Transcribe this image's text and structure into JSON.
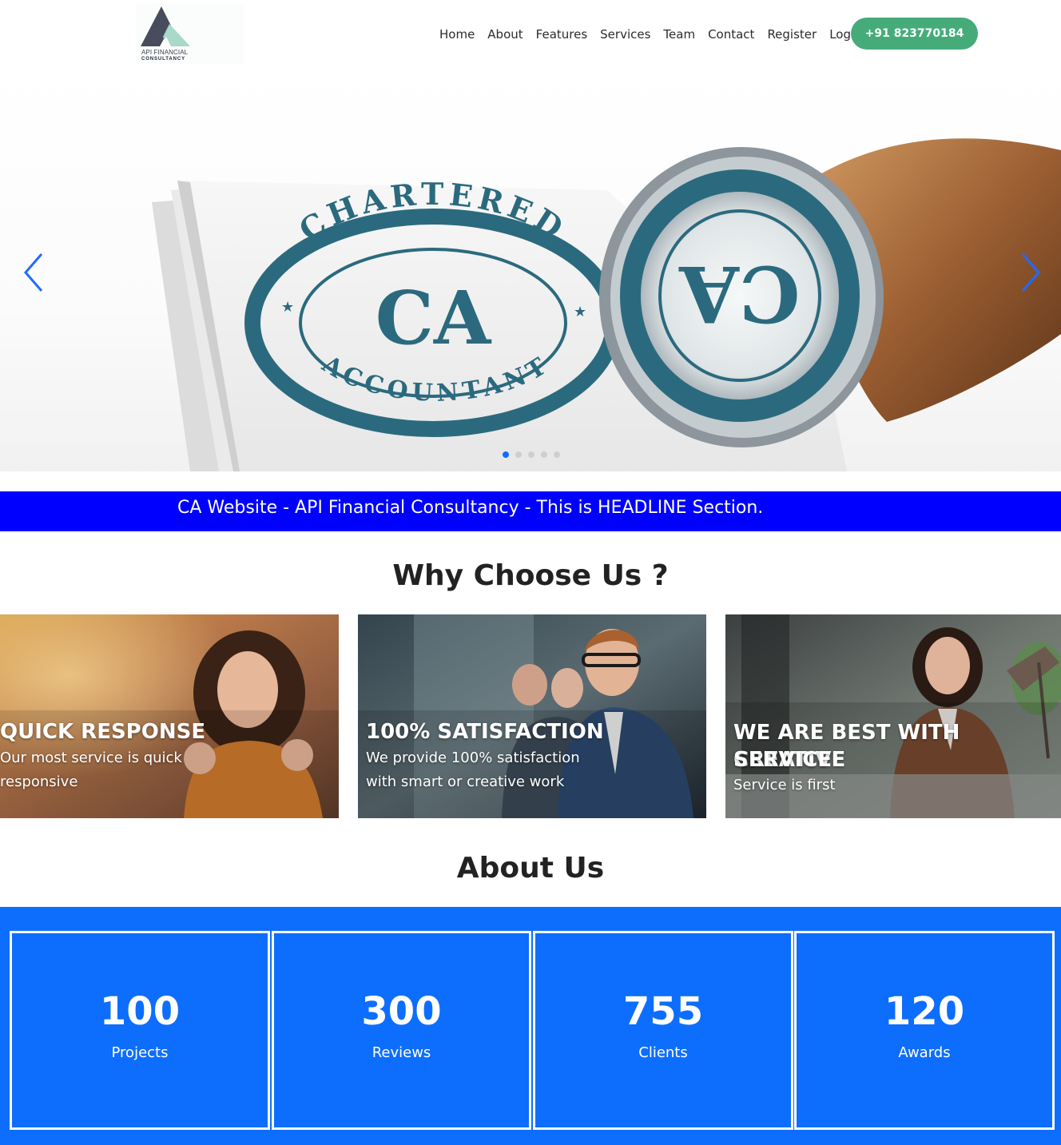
{
  "brand": {
    "line1": "API FINANCIAL",
    "line2": "CONSULTANCY"
  },
  "nav": {
    "links": [
      "Home",
      "About",
      "Features",
      "Services",
      "Team",
      "Contact",
      "Register",
      "Login"
    ],
    "phone": "+91 823770184"
  },
  "hero": {
    "document_seal": {
      "top_text": "CHARTERED",
      "center": "CA",
      "bottom_text": "ACCOUNTANT"
    },
    "stamp": {
      "center": "CA"
    },
    "slide_count": 5,
    "active_slide": 1,
    "prev_icon": "chevron-left-icon",
    "next_icon": "chevron-right-icon"
  },
  "headline": {
    "text": "CA Website - API Financial Consultancy - This is HEADLINE Section."
  },
  "why": {
    "title": "Why Choose Us ?",
    "cards": [
      {
        "title": "QUICK RESPONSE",
        "text_lines": [
          "Our most service is quick",
          "responsive"
        ]
      },
      {
        "title": "100% SATISFACTION",
        "text_lines": [
          "We provide 100% satisfaction",
          "with smart or creative work"
        ]
      },
      {
        "title_lines": [
          "WE ARE BEST WITH CREATIVE",
          "SERVICE"
        ],
        "text_lines": [
          "Service is first"
        ]
      }
    ]
  },
  "about": {
    "title": "About Us",
    "stats": [
      {
        "value": "100",
        "label": "Projects"
      },
      {
        "value": "300",
        "label": "Reviews"
      },
      {
        "value": "755",
        "label": "Clients"
      },
      {
        "value": "120",
        "label": "Awards"
      }
    ]
  },
  "colors": {
    "phone_button": "#45ac79",
    "headline_bg": "#0000ff",
    "stats_bg": "#0d6efd",
    "seal": "#2b6a7e",
    "indicator_active": "#0d6efd"
  }
}
